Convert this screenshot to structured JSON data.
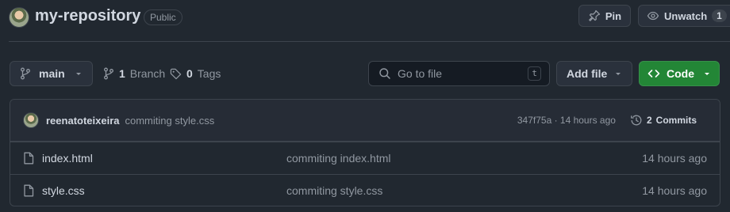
{
  "repo": {
    "name": "my-repository",
    "visibility": "Public"
  },
  "header_actions": {
    "pin_label": "Pin",
    "unwatch_label": "Unwatch",
    "watch_count": "1"
  },
  "toolbar": {
    "branch_name": "main",
    "branch_count": "1",
    "branch_word": "Branch",
    "tag_count": "0",
    "tag_word": "Tags",
    "search_placeholder": "Go to file",
    "search_shortcut": "t",
    "add_file_label": "Add file",
    "code_label": "Code"
  },
  "latest_commit": {
    "author": "reenatoteixeira",
    "message": "commiting style.css",
    "sha_and_time": "347f75a · 14 hours ago",
    "commits_count": "2",
    "commits_word": "Commits"
  },
  "files": [
    {
      "name": "index.html",
      "commit": "commiting index.html",
      "time": "14 hours ago"
    },
    {
      "name": "style.css",
      "commit": "commiting style.css",
      "time": "14 hours ago"
    }
  ],
  "colors": {
    "background": "#212830",
    "accent_green": "#238636",
    "border": "#3d444d"
  }
}
